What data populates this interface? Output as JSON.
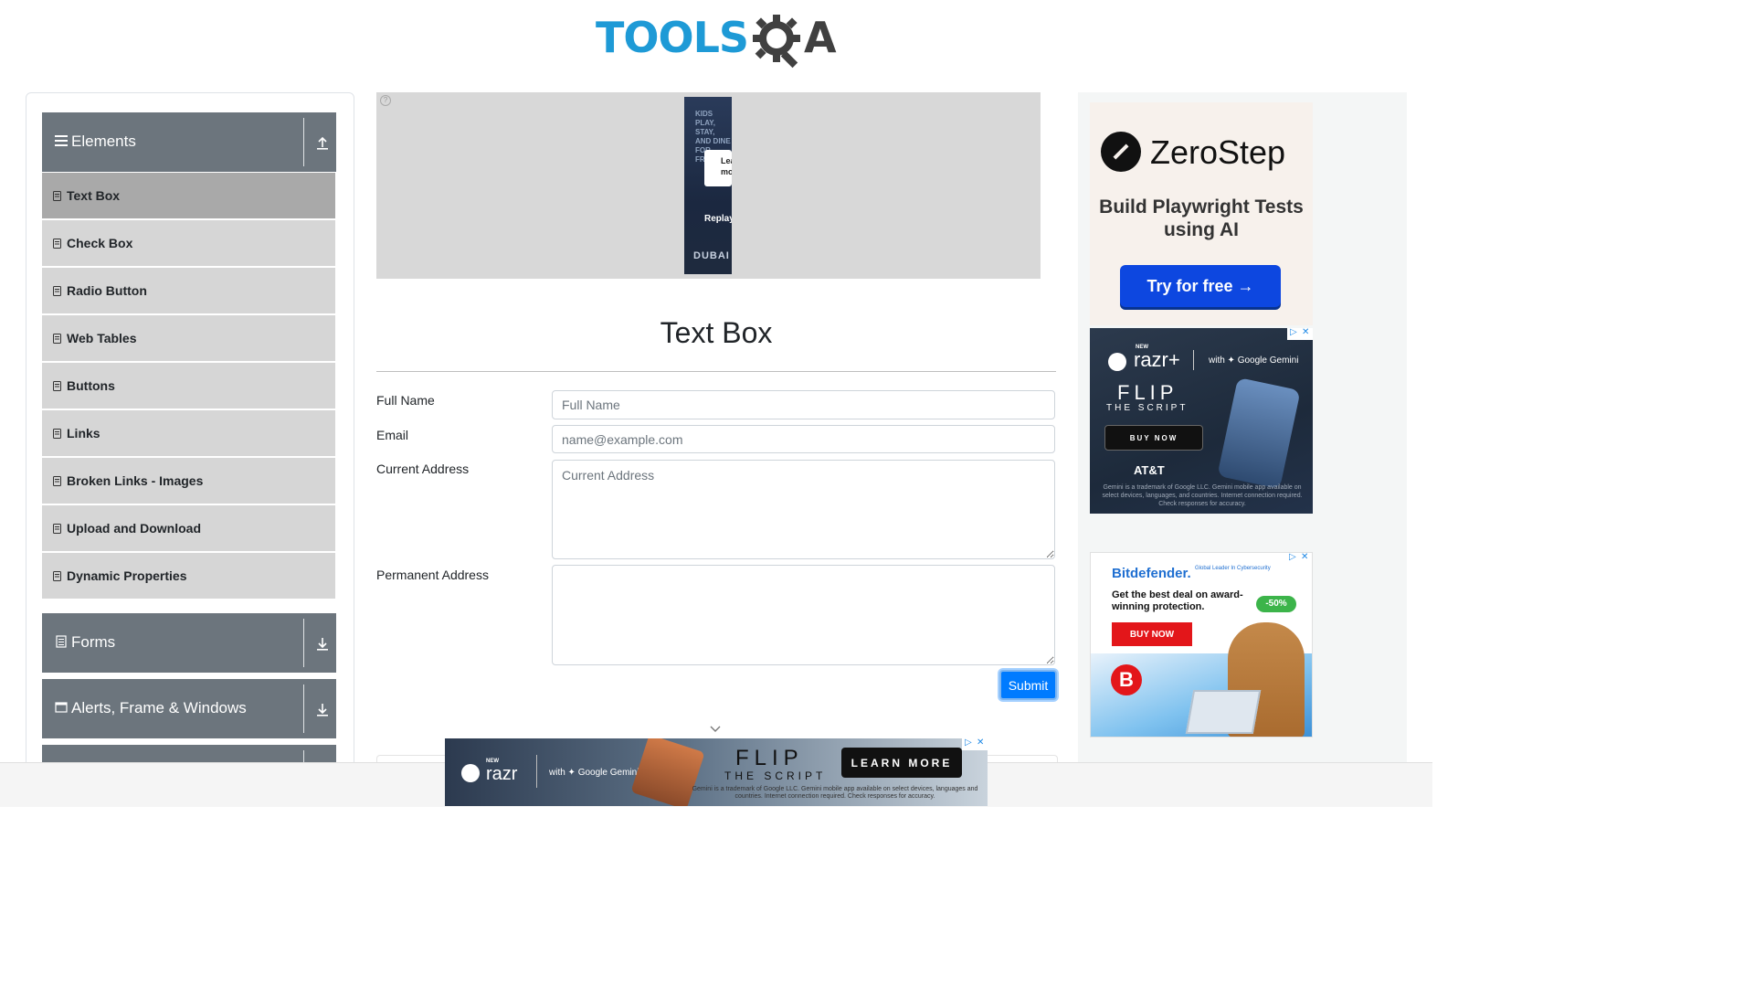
{
  "header": {
    "logo_main": "TOOLS",
    "logo_end": "A"
  },
  "sidebar": {
    "groups": [
      {
        "label": "Elements",
        "icon": "hamburger-icon",
        "state": "expanded"
      },
      {
        "label": "Forms",
        "icon": "document-icon",
        "state": "collapsed"
      },
      {
        "label": "Alerts, Frame & Windows",
        "icon": "window-icon",
        "state": "collapsed"
      }
    ],
    "items": [
      {
        "label": "Text Box",
        "active": true
      },
      {
        "label": "Check Box"
      },
      {
        "label": "Radio Button"
      },
      {
        "label": "Web Tables"
      },
      {
        "label": "Buttons"
      },
      {
        "label": "Links"
      },
      {
        "label": "Broken Links - Images"
      },
      {
        "label": "Upload and Download"
      },
      {
        "label": "Dynamic Properties"
      }
    ]
  },
  "top_ad": {
    "headline": "KIDS PLAY, STAY, AND DINE FOR FREE",
    "card": "Learn more",
    "replay": "Replay",
    "brand": "DUBAI"
  },
  "main": {
    "title": "Text Box",
    "form": {
      "full_name": {
        "label": "Full Name",
        "placeholder": "Full Name",
        "value": ""
      },
      "email": {
        "label": "Email",
        "placeholder": "name@example.com",
        "value": ""
      },
      "current_address": {
        "label": "Current Address",
        "placeholder": "Current Address",
        "value": ""
      },
      "permanent_address": {
        "label": "Permanent Address",
        "placeholder": "",
        "value": ""
      },
      "submit_label": "Submit"
    }
  },
  "right_ads": {
    "zerostep": {
      "name": "ZeroStep",
      "tagline": "Build Playwright Tests using AI",
      "cta": "Try for free →"
    },
    "razr": {
      "new": "NEW",
      "brand": "razr+",
      "gemini": "with ✦ Google Gemini",
      "flip": "FLIP",
      "script": "THE SCRIPT",
      "cta": "BUY NOW",
      "carrier": "AT&T",
      "fine": "Gemini is a trademark of Google LLC. Gemini mobile app available on select devices, languages, and countries. Internet connection required. Check responses for accuracy."
    },
    "bitdefender": {
      "brand": "Bitdefender.",
      "sub": "Global Leader In Cybersecurity",
      "deal": "Get the best deal on award-winning protection.",
      "discount": "-50%",
      "cta": "BUY NOW",
      "badge": "B"
    }
  },
  "bottom_ad": {
    "new": "NEW",
    "brand": "razr",
    "gemini": "with ✦ Google Gemini",
    "flip": "FLIP",
    "script": "THE SCRIPT",
    "cta": "LEARN MORE",
    "fine": "Gemini is a trademark of Google LLC. Gemini mobile app available on select devices, languages and countries. Internet connection required. Check responses for accuracy."
  },
  "colors": {
    "brand_blue": "#1e9ad6",
    "sidebar_header": "#6c757d",
    "menu_bg": "#d6d6d6",
    "menu_active": "#a9a9a9",
    "submit": "#007bff"
  }
}
